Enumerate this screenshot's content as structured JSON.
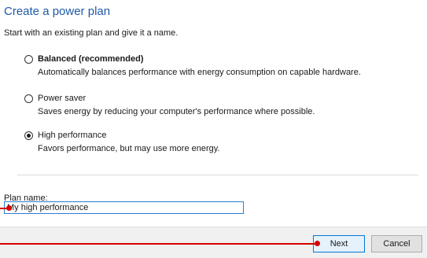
{
  "title": "Create a power plan",
  "subtitle": "Start with an existing plan and give it a name.",
  "plans": [
    {
      "label": "Balanced (recommended)",
      "description": "Automatically balances performance with energy consumption on capable hardware.",
      "selected": false
    },
    {
      "label": "Power saver",
      "description": "Saves energy by reducing your computer's performance where possible.",
      "selected": false
    },
    {
      "label": "High performance",
      "description": "Favors performance, but may use more energy.",
      "selected": true
    }
  ],
  "plan_name": {
    "label": "Plan name:",
    "value": "My high performance"
  },
  "buttons": {
    "next": "Next",
    "cancel": "Cancel"
  },
  "colors": {
    "title": "#1e5aa8",
    "annotation": "#d40000",
    "focus_border": "#0078d7"
  }
}
